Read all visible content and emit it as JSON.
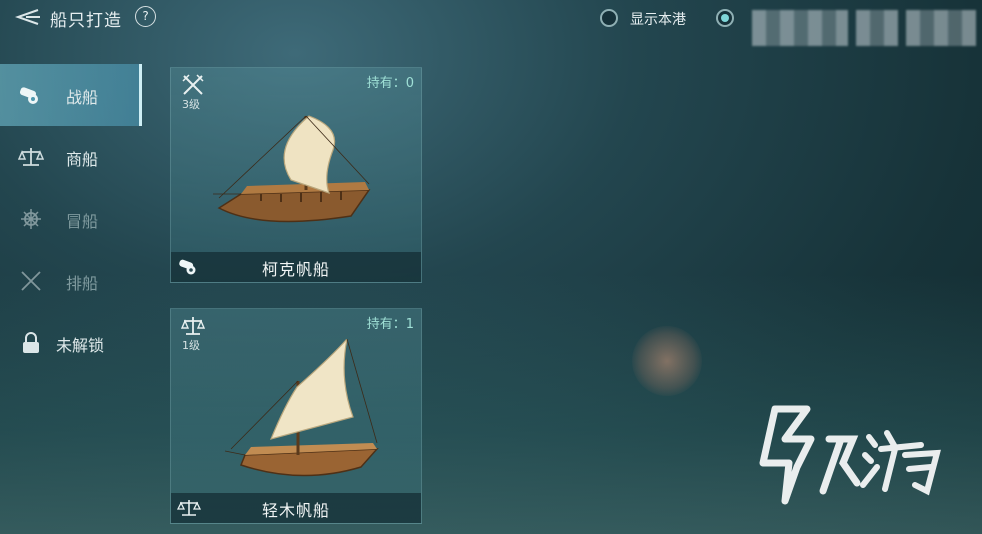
{
  "header": {
    "title": "船只打造",
    "help_label": "?",
    "show_port_label": "显示本港",
    "show_port_selected": false,
    "second_option_selected": true
  },
  "sidebar": {
    "items": [
      {
        "label": "战船",
        "icon": "cannon-icon",
        "active": true
      },
      {
        "label": "商船",
        "icon": "scales-icon"
      },
      {
        "label": "冒船",
        "icon": "helm-wheel-icon"
      },
      {
        "label": "排船",
        "icon": "crossed-swords-icon"
      },
      {
        "label": "未解锁",
        "icon": "lock-icon"
      }
    ]
  },
  "ships": [
    {
      "name": "柯克帆船",
      "tier": "3级",
      "owned": "持有：0",
      "tier_icon": "crossed-swords-icon",
      "type_icon": "cannon-icon"
    },
    {
      "name": "轻木帆船",
      "tier": "1级",
      "owned": "持有：1",
      "tier_icon": "scales-icon",
      "type_icon": "scales-icon"
    }
  ],
  "colors": {
    "accent": "#7fd6d8",
    "owned_text": "#9fe0d6",
    "active_tab": "#5fa8c0"
  },
  "watermark": {
    "logo_icon": "jiuyou-logo-icon",
    "text": "九游"
  }
}
